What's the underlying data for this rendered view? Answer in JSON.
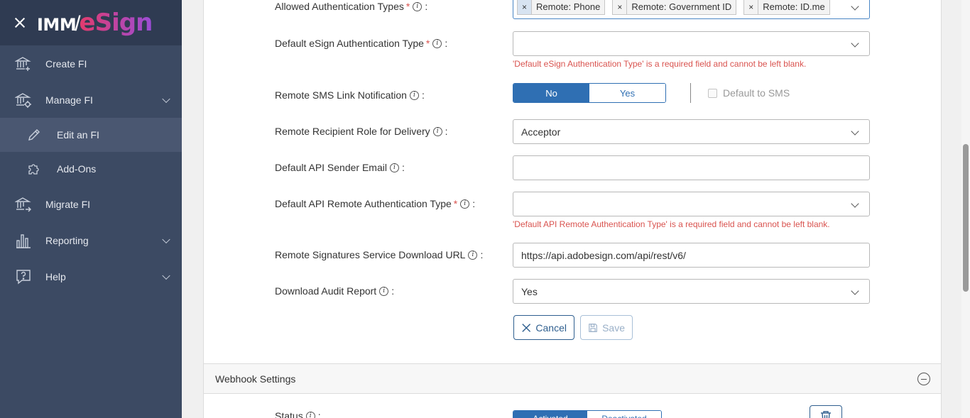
{
  "app": {
    "logo_imm": "IMM",
    "logo_esign": "eSign"
  },
  "sidebar": {
    "items": [
      {
        "label": "Create FI",
        "icon": "bank-add-icon"
      },
      {
        "label": "Manage FI",
        "icon": "bank-gear-icon"
      },
      {
        "label": "Edit an FI",
        "icon": "pencil-icon"
      },
      {
        "label": "Add-Ons",
        "icon": "puzzle-icon"
      },
      {
        "label": "Migrate FI",
        "icon": "bank-arrow-icon"
      },
      {
        "label": "Reporting",
        "icon": "bar-chart-icon"
      },
      {
        "label": "Help",
        "icon": "help-bubble-icon"
      }
    ]
  },
  "form": {
    "allowed_auth": {
      "label": "Allowed Authentication Types",
      "tags": [
        "Remote: Phone",
        "Remote: Government ID",
        "Remote: ID.me"
      ]
    },
    "default_esign_auth": {
      "label": "Default eSign Authentication Type",
      "value": "",
      "error": "'Default eSign Authentication Type' is a required field and cannot be left blank."
    },
    "remote_sms": {
      "label": "Remote SMS Link Notification",
      "options": [
        "No",
        "Yes"
      ],
      "selected": "No",
      "checkbox_label": "Default to SMS"
    },
    "recipient_role": {
      "label": "Remote Recipient Role for Delivery",
      "value": "Acceptor"
    },
    "api_sender_email": {
      "label": "Default API Sender Email",
      "value": ""
    },
    "api_remote_auth": {
      "label": "Default API Remote Authentication Type",
      "value": "",
      "error": "'Default API Remote Authentication Type' is a required field and cannot be left blank."
    },
    "download_url": {
      "label": "Remote Signatures Service Download URL",
      "value": "https://api.adobesign.com/api/rest/v6/"
    },
    "audit_report": {
      "label": "Download Audit Report",
      "value": "Yes"
    },
    "cancel_label": "Cancel",
    "save_label": "Save"
  },
  "webhook": {
    "title": "Webhook Settings",
    "status_label": "Status",
    "status_options": [
      "Activated",
      "Deactivated"
    ]
  },
  "colors": {
    "sidebar_bg": "#3c4a63",
    "accent": "#2f6fb3",
    "error": "#d9534f"
  }
}
